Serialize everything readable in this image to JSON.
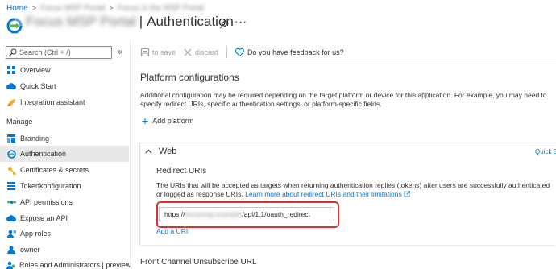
{
  "breadcrumb": {
    "home": "Home",
    "item2": "Focus MSP Portal",
    "item3": "Focus in the MSP Portal"
  },
  "header": {
    "app_name": "Focus MSP Portal",
    "separator": "|",
    "page_title": "Authentication",
    "more": "···"
  },
  "sidebar": {
    "search_placeholder": "Search (Ctrl + /)",
    "collapse": "«",
    "section_manage": "Manage",
    "items": [
      {
        "label": "Overview",
        "icon": "grid-icon"
      },
      {
        "label": "Quick Start",
        "icon": "cloud-icon"
      },
      {
        "label": "Integration assistant",
        "icon": "rocket-icon"
      },
      {
        "label": "Branding",
        "icon": "branding-icon"
      },
      {
        "label": "Authentication",
        "icon": "authentication-icon"
      },
      {
        "label": "Certificates & secrets",
        "icon": "key-icon"
      },
      {
        "label": "Tokenkonfiguration",
        "icon": "token-icon"
      },
      {
        "label": "API permissions",
        "icon": "api-icon"
      },
      {
        "label": "Expose an API",
        "icon": "cloud-icon"
      },
      {
        "label": "App roles",
        "icon": "roles-icon"
      },
      {
        "label": "owner",
        "icon": "user-icon"
      },
      {
        "label": "Roles and Administrators | preview",
        "icon": "admin-icon"
      }
    ]
  },
  "toolbar": {
    "save": "to save",
    "discard": "discard",
    "feedback": "Do you have feedback for us?"
  },
  "main": {
    "heading": "Platform configurations",
    "description": "Additional configuration may be required depending on the target platform or device for this application. For example, you may need to specify redirect URIs, specific authentication settings, or platform-specific fields.",
    "add_platform": "Add platform",
    "web": {
      "title": "Web",
      "quick_link": "Quick S",
      "redirect_title": "Redirect URIs",
      "redirect_desc": "The URIs that will be accepted as targets when returning authentication replies (tokens) after users are successfully authenticated or logged as response URIs.",
      "learn_more": "Learn more about redirect URIs and their limitations",
      "uri_prefix": "https://",
      "uri_hidden": "focusmsp.example",
      "uri_suffix": "/api/1.1/oauth_redirect",
      "add_uri": "Add a URI"
    },
    "front_channel_title": "Front Channel Unsubscribe URL"
  },
  "colors": {
    "accent": "#0078d4",
    "highlight": "#e0302c",
    "text": "#323130"
  }
}
